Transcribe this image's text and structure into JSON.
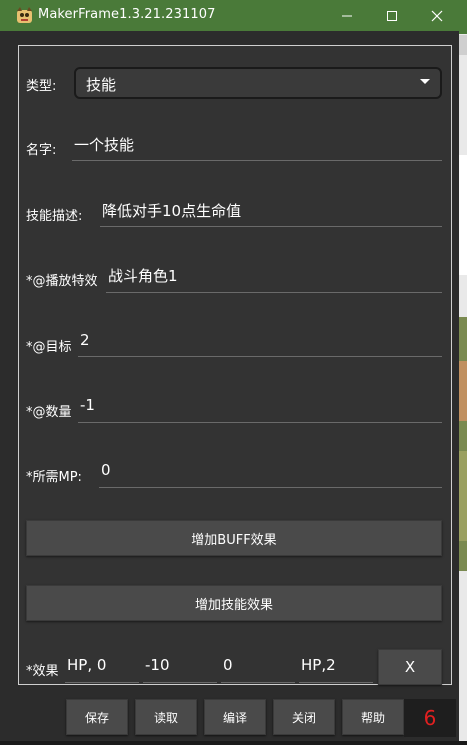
{
  "window": {
    "title": "MakerFrame1.3.21.231107",
    "accent_color": "#4a7a39",
    "background_color": "#2c2c2c"
  },
  "form": {
    "type": {
      "label": "类型:",
      "value": "技能"
    },
    "name": {
      "label": "名字:",
      "value": "一个技能"
    },
    "description": {
      "label": "技能描述:",
      "value": "降低对手10点生命值"
    },
    "effect_anim": {
      "label": "*@播放特效",
      "value": "战斗角色1"
    },
    "target": {
      "label": "*@目标",
      "value": "2"
    },
    "count": {
      "label": "*@数量",
      "value": "-1"
    },
    "mp": {
      "label": "*所需MP:",
      "value": "0"
    }
  },
  "buttons": {
    "add_buff": "增加BUFF效果",
    "add_skill": "增加技能效果"
  },
  "effect_row": {
    "label": "*效果",
    "values": [
      "HP, 0",
      "-10",
      "0",
      "HP,2"
    ],
    "remove_label": "X"
  },
  "bottom_bar": {
    "save": "保存",
    "load": "读取",
    "compile": "编译",
    "close": "关闭",
    "help": "帮助",
    "badge": "6",
    "badge_color": "#e02020"
  }
}
